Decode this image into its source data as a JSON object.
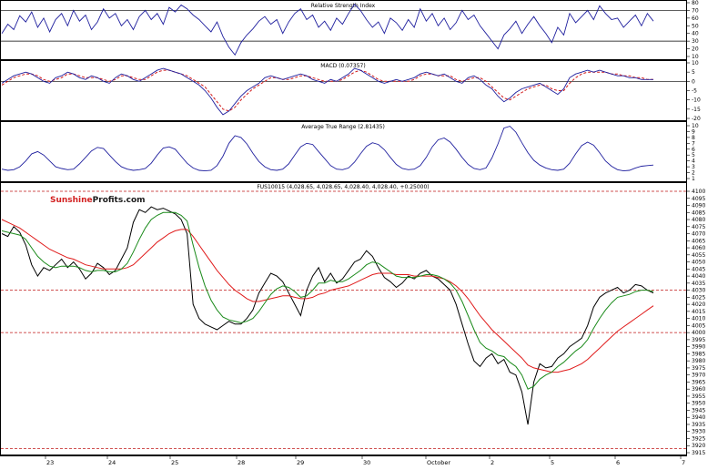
{
  "chart_data": [
    {
      "type": "line",
      "title": "Relative Strength Index",
      "ylim": [
        0,
        80
      ],
      "yticks": [
        "80",
        "70",
        "60",
        "50",
        "40",
        "30",
        "20",
        "10"
      ],
      "reference_lines": [
        70,
        30
      ],
      "colors": {
        "line": "#1f1f9e",
        "reference": "#000000"
      },
      "series": [
        {
          "values": [
            40,
            52,
            45,
            63,
            55,
            68,
            48,
            60,
            42,
            58,
            66,
            50,
            70,
            56,
            64,
            45,
            55,
            72,
            60,
            66,
            50,
            58,
            45,
            62,
            70,
            58,
            66,
            52,
            74,
            68,
            77,
            72,
            64,
            58,
            50,
            42,
            55,
            36,
            22,
            12,
            28,
            38,
            46,
            56,
            62,
            52,
            58,
            40,
            55,
            66,
            72,
            58,
            64,
            48,
            56,
            44,
            60,
            52,
            66,
            78,
            70,
            58,
            48,
            55,
            40,
            60,
            54,
            44,
            58,
            48,
            72,
            56,
            66,
            50,
            60,
            45,
            54,
            70,
            58,
            64,
            50,
            40,
            30,
            20,
            38,
            46,
            56,
            40,
            52,
            62,
            50,
            40,
            28,
            48,
            38,
            66,
            54,
            62,
            70,
            58,
            76,
            66,
            58,
            60,
            48,
            56,
            64,
            50,
            66,
            56
          ]
        }
      ]
    },
    {
      "type": "line",
      "title": "MACD (0.07357)",
      "ylim": [
        -20,
        10
      ],
      "yticks": [
        "10",
        "5",
        "0",
        "-5",
        "-10",
        "-15",
        "-20"
      ],
      "colors": {
        "macd": "#1f1f9e",
        "signal": "#d21a1a",
        "zero": "#000000"
      },
      "series": [
        {
          "name": "MACD",
          "values": [
            -1,
            1,
            3,
            4,
            5,
            4,
            2,
            0,
            -1,
            2,
            3,
            5,
            4,
            2,
            1,
            3,
            2,
            0,
            -1,
            2,
            4,
            3,
            1,
            0,
            2,
            4,
            6,
            7,
            6,
            5,
            4,
            2,
            0,
            -2,
            -5,
            -9,
            -14,
            -18,
            -16,
            -12,
            -8,
            -5,
            -3,
            -1,
            2,
            3,
            2,
            1,
            2,
            3,
            4,
            3,
            1,
            0,
            -1,
            1,
            0,
            2,
            4,
            7,
            6,
            4,
            2,
            0,
            -1,
            0,
            1,
            0,
            1,
            2,
            4,
            5,
            4,
            3,
            4,
            2,
            0,
            -1,
            2,
            3,
            1,
            -2,
            -4,
            -8,
            -11,
            -9,
            -6,
            -4,
            -3,
            -2,
            -1,
            -3,
            -5,
            -7,
            -4,
            2,
            4,
            5,
            6,
            5,
            6,
            5,
            4,
            3,
            3,
            2,
            2,
            1,
            1,
            1
          ]
        },
        {
          "name": "Signal",
          "values": [
            -2,
            0,
            2,
            3,
            4,
            4,
            3,
            1,
            0,
            1,
            2,
            4,
            4,
            3,
            2,
            2,
            2,
            1,
            0,
            1,
            3,
            3,
            2,
            1,
            1,
            3,
            5,
            6,
            6,
            5,
            4,
            3,
            1,
            -1,
            -3,
            -7,
            -11,
            -15,
            -16,
            -14,
            -10,
            -7,
            -4,
            -2,
            0,
            2,
            2,
            1,
            1,
            2,
            3,
            3,
            2,
            1,
            0,
            0,
            0,
            1,
            3,
            5,
            6,
            5,
            3,
            1,
            0,
            0,
            0,
            0,
            0,
            1,
            3,
            4,
            4,
            3,
            3,
            3,
            1,
            0,
            1,
            2,
            2,
            0,
            -3,
            -6,
            -9,
            -10,
            -8,
            -6,
            -4,
            -3,
            -2,
            -2,
            -4,
            -5,
            -5,
            -1,
            2,
            4,
            5,
            5,
            5,
            5,
            4,
            4,
            3,
            3,
            2,
            2,
            1,
            1
          ]
        }
      ]
    },
    {
      "type": "line",
      "title": "Average True Range (2.81435)",
      "ylim": [
        1,
        10
      ],
      "yticks": [
        "10",
        "9",
        "8",
        "7",
        "6",
        "5",
        "4",
        "3",
        "2",
        "1"
      ],
      "colors": {
        "line": "#1f1f9e"
      },
      "series": [
        {
          "values": [
            2.6,
            2.4,
            2.5,
            3.0,
            4.0,
            5.2,
            5.6,
            5.0,
            4.0,
            3.0,
            2.7,
            2.5,
            2.6,
            3.5,
            4.6,
            5.7,
            6.3,
            6.1,
            5.0,
            3.9,
            3.0,
            2.6,
            2.4,
            2.5,
            2.7,
            3.6,
            5.0,
            6.2,
            6.4,
            6.0,
            4.8,
            3.6,
            2.8,
            2.4,
            2.3,
            2.4,
            3.2,
            4.8,
            7.0,
            8.3,
            8.0,
            6.9,
            5.3,
            3.9,
            3.0,
            2.5,
            2.4,
            2.6,
            3.5,
            5.0,
            6.4,
            7.0,
            6.8,
            5.6,
            4.4,
            3.2,
            2.6,
            2.5,
            2.8,
            3.8,
            5.2,
            6.5,
            7.1,
            6.8,
            5.9,
            4.6,
            3.4,
            2.7,
            2.5,
            2.6,
            3.2,
            4.6,
            6.4,
            7.6,
            7.9,
            7.2,
            6.0,
            4.6,
            3.4,
            2.7,
            2.5,
            2.8,
            4.5,
            6.9,
            9.6,
            9.9,
            8.9,
            7.1,
            5.4,
            4.1,
            3.3,
            2.8,
            2.5,
            2.4,
            2.6,
            3.6,
            5.2,
            6.6,
            7.2,
            6.7,
            5.4,
            4.0,
            3.1,
            2.5,
            2.3,
            2.4,
            2.8,
            3.1,
            3.2,
            3.3
          ]
        }
      ]
    },
    {
      "type": "line",
      "title": "FUS10015 (4,028.65, 4,028.65, 4,028.40, 4,028.40, +0.25000)",
      "watermark": {
        "part1": "Sunshine",
        "part2": "Profits.com"
      },
      "ylim": [
        3915,
        4100
      ],
      "yticks": [
        "4100",
        "4095",
        "4090",
        "4085",
        "4080",
        "4075",
        "4070",
        "4065",
        "4060",
        "4055",
        "4050",
        "4045",
        "4040",
        "4035",
        "4030",
        "4025",
        "4020",
        "4015",
        "4010",
        "4005",
        "4000",
        "3995",
        "3990",
        "3985",
        "3980",
        "3975",
        "3970",
        "3965",
        "3960",
        "3955",
        "3950",
        "3945",
        "3940",
        "3935",
        "3930",
        "3925",
        "3920",
        "3915"
      ],
      "reference_lines": [
        4100,
        4030,
        4000,
        3918
      ],
      "xticks": [
        "23",
        "24",
        "25",
        "28",
        "29",
        "30",
        "October",
        "2",
        "5",
        "6",
        "7"
      ],
      "colors": {
        "price": "#000000",
        "ma_short": "#1a8a1a",
        "ma_long": "#e01a1a",
        "reference": "#c01818"
      },
      "series": [
        {
          "name": "Price",
          "values": [
            4070,
            4068,
            4075,
            4071,
            4062,
            4048,
            4040,
            4046,
            4044,
            4048,
            4052,
            4046,
            4050,
            4045,
            4038,
            4042,
            4049,
            4046,
            4041,
            4044,
            4052,
            4060,
            4078,
            4087,
            4085,
            4089,
            4087,
            4088,
            4086,
            4084,
            4080,
            4070,
            4020,
            4010,
            4006,
            4004,
            4002,
            4005,
            4008,
            4006,
            4006,
            4010,
            4016,
            4028,
            4035,
            4042,
            4040,
            4036,
            4028,
            4020,
            4012,
            4030,
            4040,
            4046,
            4036,
            4042,
            4035,
            4038,
            4044,
            4050,
            4052,
            4058,
            4054,
            4046,
            4039,
            4036,
            4032,
            4035,
            4040,
            4038,
            4042,
            4044,
            4040,
            4038,
            4034,
            4030,
            4020,
            4006,
            3992,
            3980,
            3976,
            3982,
            3985,
            3978,
            3981,
            3972,
            3970,
            3958,
            3935,
            3965,
            3978,
            3975,
            3976,
            3982,
            3985,
            3990,
            3993,
            3996,
            4005,
            4018,
            4025,
            4028,
            4030,
            4032,
            4028,
            4030,
            4034,
            4033,
            4030,
            4028
          ]
        },
        {
          "name": "MA short",
          "values": [
            4072,
            4071,
            4070,
            4069,
            4066,
            4060,
            4054,
            4050,
            4047,
            4046,
            4047,
            4047,
            4047,
            4046,
            4044,
            4043,
            4044,
            4044,
            4043,
            4043,
            4045,
            4049,
            4057,
            4066,
            4074,
            4080,
            4083,
            4085,
            4085,
            4085,
            4083,
            4079,
            4062,
            4046,
            4033,
            4023,
            4016,
            4011,
            4009,
            4008,
            4007,
            4008,
            4010,
            4015,
            4021,
            4027,
            4031,
            4033,
            4032,
            4029,
            4025,
            4026,
            4030,
            4035,
            4035,
            4037,
            4036,
            4036,
            4038,
            4041,
            4044,
            4048,
            4050,
            4049,
            4046,
            4043,
            4040,
            4039,
            4039,
            4039,
            4040,
            4041,
            4041,
            4040,
            4038,
            4035,
            4030,
            4022,
            4012,
            4002,
            3993,
            3989,
            3987,
            3984,
            3983,
            3979,
            3976,
            3970,
            3960,
            3962,
            3967,
            3970,
            3972,
            3976,
            3979,
            3983,
            3987,
            3990,
            3995,
            4003,
            4010,
            4016,
            4021,
            4025,
            4026,
            4027,
            4029,
            4030,
            4030,
            4029
          ]
        },
        {
          "name": "MA long",
          "values": [
            4080,
            4078,
            4076,
            4074,
            4071,
            4068,
            4065,
            4062,
            4059,
            4057,
            4055,
            4053,
            4052,
            4050,
            4048,
            4047,
            4046,
            4045,
            4045,
            4045,
            4045,
            4046,
            4048,
            4052,
            4056,
            4060,
            4064,
            4067,
            4070,
            4072,
            4073,
            4073,
            4068,
            4062,
            4056,
            4050,
            4044,
            4039,
            4034,
            4030,
            4027,
            4024,
            4022,
            4022,
            4023,
            4024,
            4025,
            4026,
            4026,
            4025,
            4024,
            4024,
            4025,
            4027,
            4028,
            4030,
            4031,
            4032,
            4033,
            4035,
            4037,
            4039,
            4041,
            4042,
            4042,
            4042,
            4041,
            4041,
            4041,
            4040,
            4040,
            4040,
            4040,
            4039,
            4038,
            4036,
            4033,
            4029,
            4024,
            4018,
            4012,
            4007,
            4002,
            3998,
            3994,
            3990,
            3986,
            3982,
            3977,
            3975,
            3974,
            3973,
            3972,
            3972,
            3973,
            3974,
            3976,
            3978,
            3981,
            3985,
            3989,
            3993,
            3997,
            4001,
            4004,
            4007,
            4010,
            4013,
            4016,
            4019
          ]
        }
      ]
    }
  ]
}
